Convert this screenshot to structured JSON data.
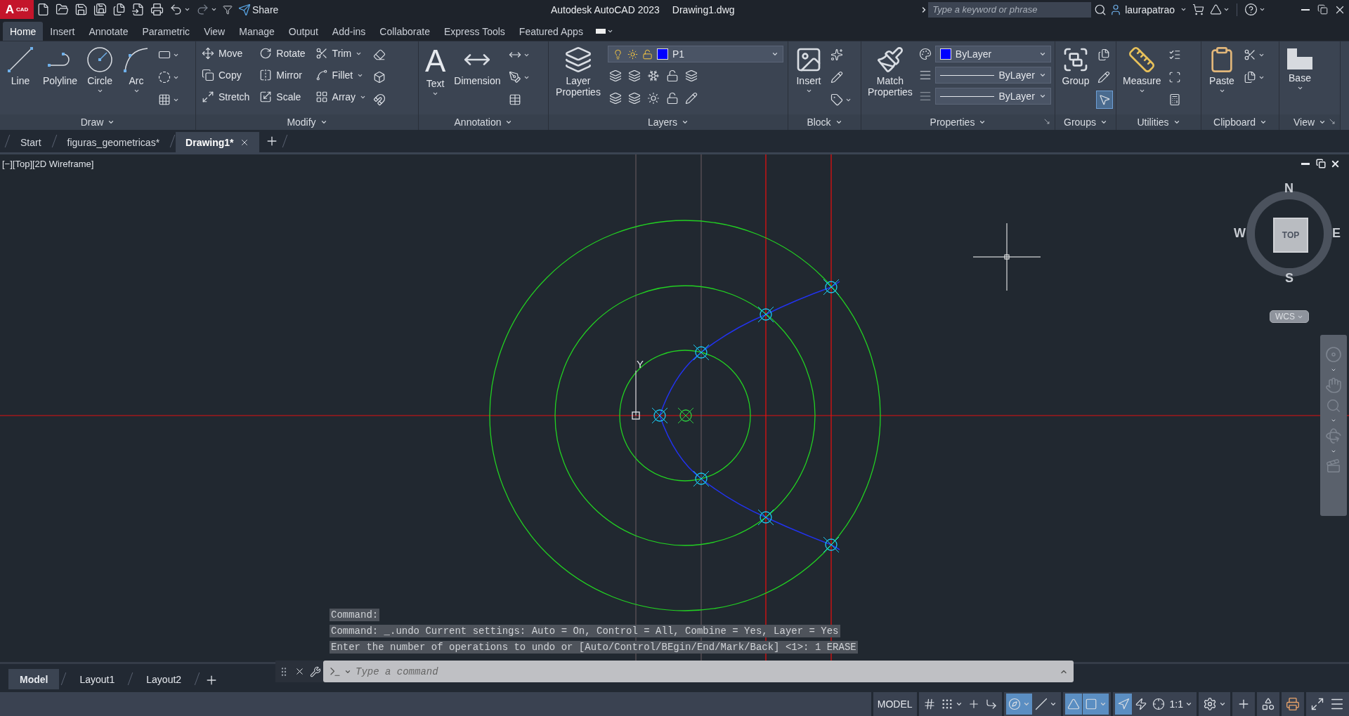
{
  "title_bar": {
    "logo": {
      "letter": "A",
      "sub": "CAD"
    },
    "share": "Share",
    "app_title": "Autodesk AutoCAD 2023",
    "file_name": "Drawing1.dwg",
    "search": {
      "placeholder": "Type a keyword or phrase"
    },
    "user": "laurapatrao"
  },
  "ribbon_tabs": [
    {
      "label": "Home",
      "selected": true
    },
    {
      "label": "Insert",
      "selected": false
    },
    {
      "label": "Annotate",
      "selected": false
    },
    {
      "label": "Parametric",
      "selected": false
    },
    {
      "label": "View",
      "selected": false
    },
    {
      "label": "Manage",
      "selected": false
    },
    {
      "label": "Output",
      "selected": false
    },
    {
      "label": "Add-ins",
      "selected": false
    },
    {
      "label": "Collaborate",
      "selected": false
    },
    {
      "label": "Express Tools",
      "selected": false
    },
    {
      "label": "Featured Apps",
      "selected": false
    }
  ],
  "ribbon_panels": [
    {
      "title": "Draw",
      "tools": [
        {
          "label": "Line"
        },
        {
          "label": "Polyline"
        },
        {
          "label": "Circle"
        },
        {
          "label": "Arc"
        }
      ]
    },
    {
      "title": "Modify",
      "tools": [
        {
          "label": "Move"
        },
        {
          "label": "Copy"
        },
        {
          "label": "Stretch"
        },
        {
          "label": "Rotate"
        },
        {
          "label": "Mirror"
        },
        {
          "label": "Scale"
        },
        {
          "label": "Trim"
        },
        {
          "label": "Fillet"
        },
        {
          "label": "Array"
        }
      ]
    },
    {
      "title": "Annotation",
      "tools": [
        {
          "label": "Text",
          "glyph": "A"
        },
        {
          "label": "Dimension"
        }
      ]
    },
    {
      "title": "Layers",
      "tools": [
        {
          "label": "Layer Properties"
        }
      ],
      "dropdowns": [
        {
          "value": "P1"
        }
      ]
    },
    {
      "title": "Block",
      "tools": [
        {
          "label": "Insert"
        }
      ]
    },
    {
      "title": "Properties",
      "tools": [
        {
          "label": "Match Properties"
        }
      ],
      "dropdowns": [
        {
          "value": "ByLayer"
        },
        {
          "value": "ByLayer"
        },
        {
          "value": "ByLayer"
        }
      ]
    },
    {
      "title": "Groups",
      "tools": [
        {
          "label": "Group"
        }
      ]
    },
    {
      "title": "Utilities",
      "tools": [
        {
          "label": "Measure"
        }
      ]
    },
    {
      "title": "Clipboard",
      "tools": [
        {
          "label": "Paste"
        }
      ]
    },
    {
      "title": "View",
      "tools": [
        {
          "label": "Base"
        }
      ]
    }
  ],
  "file_tabs": [
    {
      "label": "Start",
      "selected": false
    },
    {
      "label": "figuras_geometricas*",
      "selected": false
    },
    {
      "label": "Drawing1*",
      "selected": true
    }
  ],
  "viewport": {
    "label": "[−][Top][2D Wireframe]",
    "ucs_label": "Y",
    "viewcube": {
      "north": "N",
      "east": "E",
      "south": "S",
      "west": "W",
      "face": "TOP",
      "coordinate_system": "WCS"
    }
  },
  "command_history": [
    "Command:",
    "Command: _.undo Current settings: Auto = On, Control = All, Combine = Yes, Layer = Yes",
    "Enter the number of operations to undo or [Auto/Control/BEgin/End/Mark/Back] <1>: 1 ERASE"
  ],
  "command_input": {
    "placeholder": "Type a command"
  },
  "layout_tabs": [
    {
      "label": "Model",
      "selected": true
    },
    {
      "label": "Layout1",
      "selected": false
    },
    {
      "label": "Layout2",
      "selected": false
    }
  ],
  "status_bar": {
    "mode": "MODEL",
    "toggles": [
      {
        "on": false
      },
      {
        "on": false
      },
      {
        "on": false
      },
      {
        "on": false
      },
      {
        "on": true
      },
      {
        "on": false
      },
      {
        "on": true
      },
      {
        "on": true
      },
      {
        "on": true
      },
      {
        "on": false
      },
      {
        "on": false
      }
    ],
    "scale": "1:1"
  }
}
